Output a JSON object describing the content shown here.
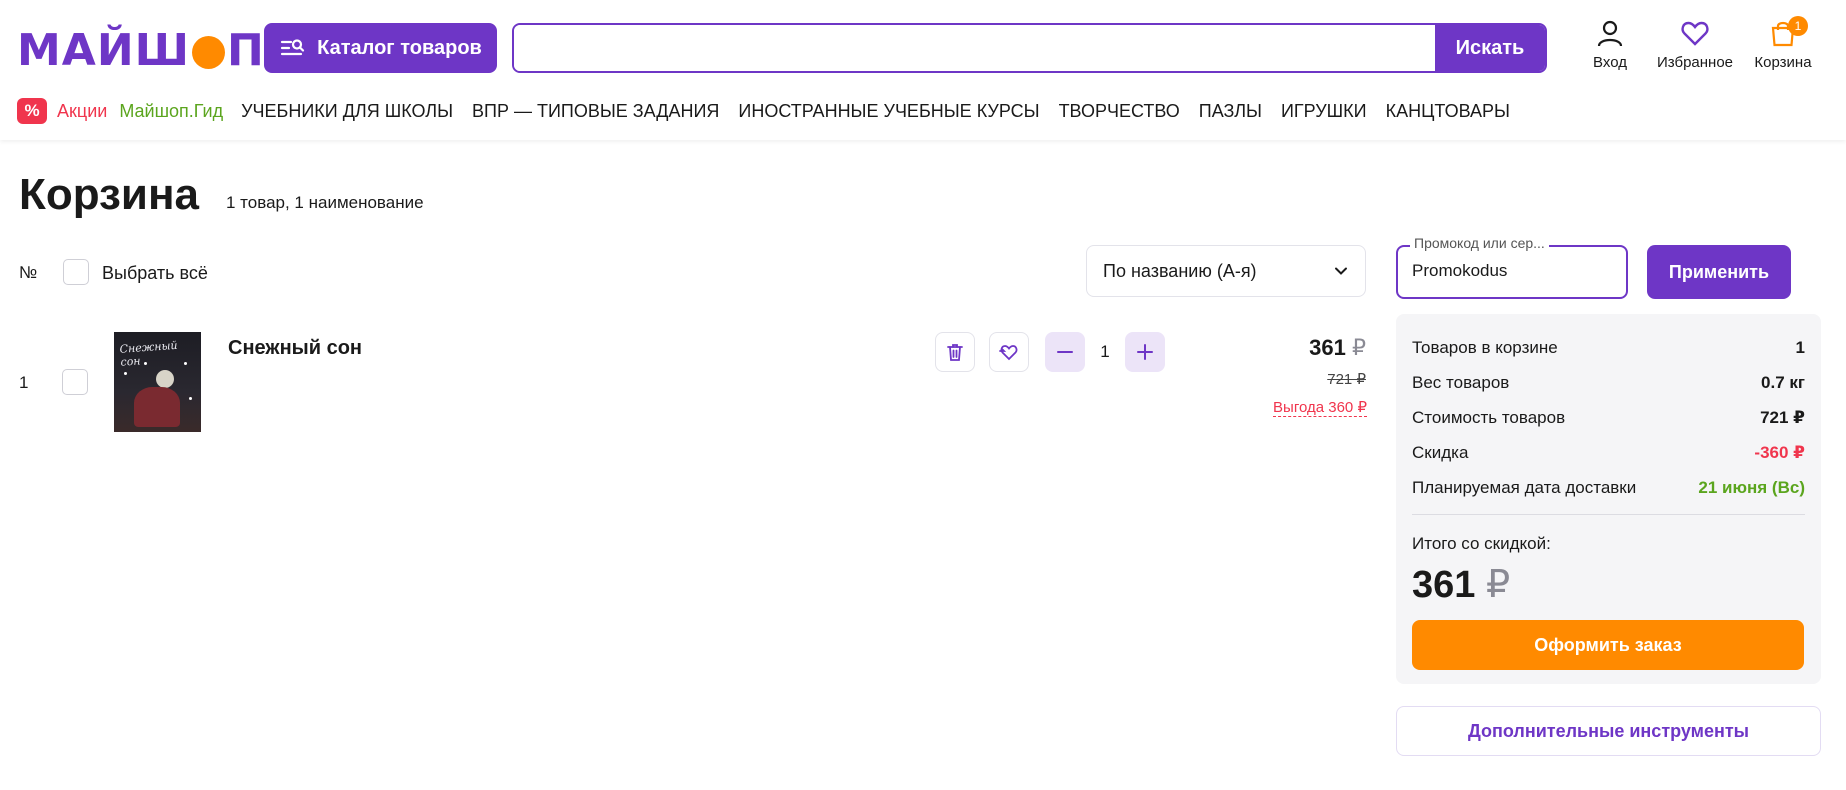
{
  "header": {
    "logo_text_left": "МАЙШ",
    "logo_text_right": "П",
    "catalog_label": "Каталог товаров",
    "search": {
      "placeholder": "",
      "value": "",
      "button_label": "Искать"
    },
    "login_label": "Вход",
    "favorites_label": "Избранное",
    "cart_label": "Корзина",
    "cart_count": "1",
    "accent_color": "#6e36c6",
    "orange_color": "#ff8a00"
  },
  "nav": {
    "percent_badge": "%",
    "promo_label": "Акции",
    "guide_label": "Майшоп.Гид",
    "categories": [
      "УЧЕБНИКИ ДЛЯ ШКОЛЫ",
      "ВПР — ТИПОВЫЕ ЗАДАНИЯ",
      "ИНОСТРАННЫЕ УЧЕБНЫЕ КУРСЫ",
      "ТВОРЧЕСТВО",
      "ПАЗЛЫ",
      "ИГРУШКИ",
      "КАНЦТОВАРЫ"
    ]
  },
  "page": {
    "title": "Корзина",
    "subtitle": "1 товар, 1 наименование"
  },
  "list": {
    "number_header": "№",
    "select_all_label": "Выбрать всё",
    "sort_value": "По названию (А-я)",
    "items": [
      {
        "index": "1",
        "name": "Снежный сон",
        "cover_title": "Снежный сон",
        "quantity": "1",
        "price": "361",
        "currency": "₽",
        "old_price": "721 ₽",
        "benefit": "Выгода 360 ₽"
      }
    ]
  },
  "sidebar": {
    "promo_legend": "Промокод или сер...",
    "promo_value": "Promokodus",
    "apply_label": "Применить",
    "summary": {
      "items_label": "Товаров в корзине",
      "items_value": "1",
      "weight_label": "Вес товаров",
      "weight_value": "0.7 кг",
      "cost_label": "Стоимость товаров",
      "cost_value": "721 ₽",
      "discount_label": "Скидка",
      "discount_value": "-360 ₽",
      "delivery_label": "Планируемая дата доставки",
      "delivery_value": "21 июня (Вс)",
      "total_label": "Итого со скидкой:",
      "total_value": "361",
      "total_currency": "₽",
      "order_label": "Оформить заказ"
    },
    "tools_label": "Дополнительные инструменты"
  }
}
